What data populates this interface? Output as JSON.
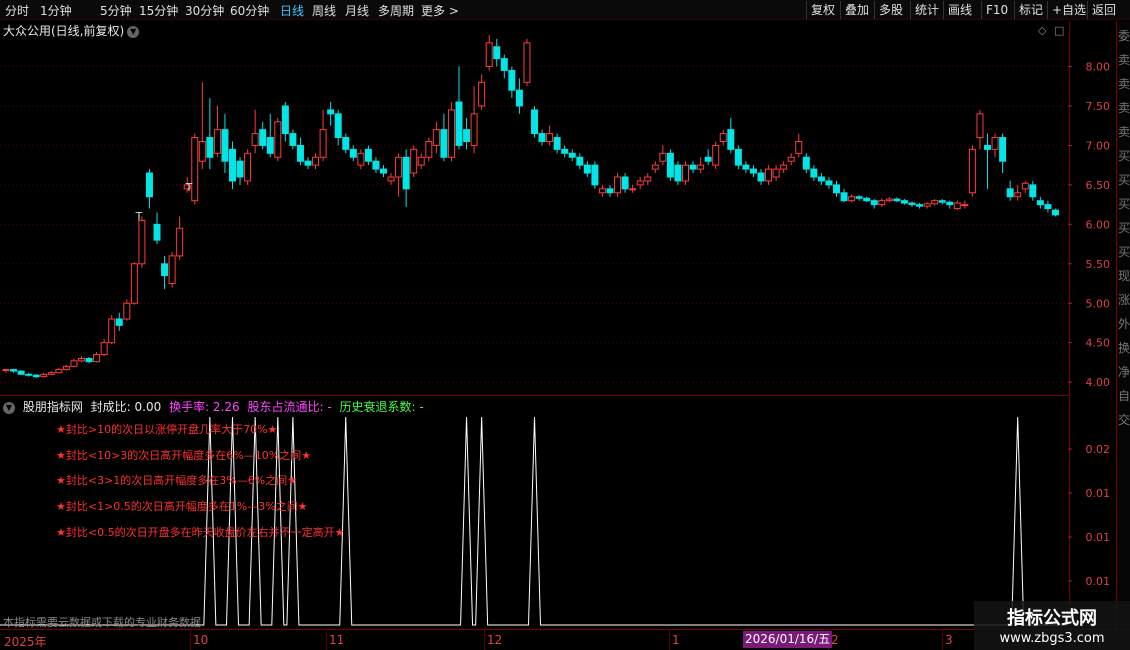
{
  "toolbar": {
    "periods": [
      "分时",
      "1分钟",
      "5分钟",
      "15分钟",
      "30分钟",
      "60分钟",
      "日线",
      "周线",
      "月线",
      "多周期",
      "更多 >"
    ],
    "active_period": "日线",
    "right_buttons": [
      "复权",
      "叠加",
      "多股",
      "统计",
      "画线",
      "F10",
      "标记",
      "+自选",
      "返回"
    ]
  },
  "main": {
    "title": "大众公用(日线,前复权)",
    "price_ticks": [
      "8.00",
      "7.50",
      "7.00",
      "6.50",
      "6.00",
      "5.50",
      "5.00",
      "4.50",
      "4.00"
    ],
    "markers": [
      "T",
      "T"
    ]
  },
  "sub": {
    "indicator_name": "股朋指标网",
    "seal_ratio": "封成比: 0.00",
    "turnover": "换手率: 2.26",
    "holder_ratio": "股东占流通比: -",
    "decline_coef": "历史衰退系数: -",
    "value_ticks": [
      "0.02",
      "0.01",
      "0.01",
      "0.01",
      "0.01"
    ],
    "notes": [
      "★封比>10的次日以涨停开盘几率大于70%★",
      "★封比<10>3的次日高开幅度多在6%—10%之间★",
      "★封比<3>1的次日高开幅度多在3%—6%之间★",
      "★封比<1>0.5的次日高开幅度多在1%—3%之间★",
      "★封比<0.5的次日开盘多在昨天收盘价左右并不一定高开★"
    ],
    "footer": "本指标需要云数据或下载的专业财务数据"
  },
  "axis": {
    "labels": [
      "2025年",
      "10",
      "11",
      "12",
      "1",
      "2",
      "3"
    ],
    "date_badge": "2026/01/16/五"
  },
  "right_strip_chars": [
    "委",
    "卖",
    "卖",
    "卖",
    "卖",
    "买",
    "买",
    "买",
    "买",
    "买",
    "现",
    "涨",
    "外",
    "换",
    "净",
    "自",
    "交"
  ],
  "watermark": {
    "title": "指标公式网",
    "url": "www.zbgs3.com"
  },
  "colors": {
    "up": "#ff3b3b",
    "down": "#00e5e5",
    "grid": "#5a0000",
    "active": "#3ec8ff"
  },
  "chart_data": {
    "type": "candlestick",
    "ylim": [
      3.85,
      8.45
    ],
    "candles": [
      [
        4.15,
        4.16,
        4.12,
        4.17
      ],
      [
        4.16,
        4.14,
        4.12,
        4.17
      ],
      [
        4.14,
        4.1,
        4.09,
        4.15
      ],
      [
        4.1,
        4.09,
        4.07,
        4.12
      ],
      [
        4.09,
        4.07,
        4.05,
        4.1
      ],
      [
        4.07,
        4.1,
        4.06,
        4.12
      ],
      [
        4.1,
        4.12,
        4.09,
        4.14
      ],
      [
        4.12,
        4.16,
        4.11,
        4.18
      ],
      [
        4.16,
        4.2,
        4.15,
        4.22
      ],
      [
        4.2,
        4.27,
        4.19,
        4.3
      ],
      [
        4.27,
        4.3,
        4.25,
        4.33
      ],
      [
        4.3,
        4.26,
        4.24,
        4.32
      ],
      [
        4.26,
        4.35,
        4.25,
        4.38
      ],
      [
        4.35,
        4.5,
        4.33,
        4.55
      ],
      [
        4.5,
        4.8,
        4.48,
        4.85
      ],
      [
        4.8,
        4.72,
        4.65,
        4.88
      ],
      [
        4.8,
        5.0,
        4.78,
        5.05
      ],
      [
        5.0,
        5.5,
        4.98,
        5.52
      ],
      [
        5.5,
        6.05,
        5.45,
        6.1
      ],
      [
        6.65,
        6.35,
        6.2,
        6.7
      ],
      [
        6.0,
        5.8,
        5.75,
        6.15
      ],
      [
        5.5,
        5.35,
        5.18,
        5.6
      ],
      [
        5.25,
        5.6,
        5.2,
        5.65
      ],
      [
        5.6,
        5.95,
        5.55,
        6.1
      ],
      [
        6.45,
        6.5,
        6.4,
        6.6
      ],
      [
        6.3,
        7.1,
        6.25,
        7.15
      ],
      [
        6.8,
        7.05,
        6.7,
        7.8
      ],
      [
        7.1,
        6.85,
        6.7,
        7.6
      ],
      [
        6.9,
        7.2,
        6.85,
        7.5
      ],
      [
        7.2,
        6.8,
        6.65,
        7.4
      ],
      [
        6.95,
        6.55,
        6.45,
        7.05
      ],
      [
        6.8,
        6.6,
        6.5,
        6.85
      ],
      [
        6.55,
        6.9,
        6.5,
        6.95
      ],
      [
        7.0,
        7.15,
        6.9,
        7.45
      ],
      [
        7.2,
        7.0,
        6.95,
        7.3
      ],
      [
        7.1,
        6.9,
        6.85,
        7.4
      ],
      [
        6.85,
        7.3,
        6.8,
        7.35
      ],
      [
        7.5,
        7.15,
        7.05,
        7.55
      ],
      [
        7.15,
        7.0,
        6.95,
        7.2
      ],
      [
        7.0,
        6.8,
        6.75,
        7.1
      ],
      [
        6.8,
        6.75,
        6.7,
        6.85
      ],
      [
        6.75,
        6.85,
        6.7,
        6.9
      ],
      [
        6.85,
        7.2,
        6.8,
        7.45
      ],
      [
        7.45,
        7.4,
        7.25,
        7.55
      ],
      [
        7.4,
        7.1,
        7.0,
        7.45
      ],
      [
        7.1,
        6.95,
        6.9,
        7.15
      ],
      [
        6.95,
        6.85,
        6.8,
        7.0
      ],
      [
        6.75,
        6.9,
        6.7,
        6.95
      ],
      [
        6.95,
        6.8,
        6.75,
        7.0
      ],
      [
        6.8,
        6.7,
        6.65,
        6.85
      ],
      [
        6.7,
        6.65,
        6.6,
        6.75
      ],
      [
        6.55,
        6.6,
        6.5,
        6.65
      ],
      [
        6.6,
        6.85,
        6.35,
        6.9
      ],
      [
        6.85,
        6.45,
        6.22,
        6.95
      ],
      [
        6.65,
        6.95,
        6.6,
        7.0
      ],
      [
        6.75,
        6.85,
        6.7,
        6.9
      ],
      [
        6.85,
        7.05,
        6.8,
        7.1
      ],
      [
        7.0,
        7.2,
        6.9,
        7.3
      ],
      [
        7.2,
        6.85,
        6.8,
        7.4
      ],
      [
        6.85,
        7.45,
        6.8,
        7.55
      ],
      [
        7.55,
        7.0,
        6.95,
        8.0
      ],
      [
        7.2,
        7.05,
        6.95,
        7.35
      ],
      [
        7.0,
        7.4,
        6.9,
        7.75
      ],
      [
        7.5,
        7.8,
        7.45,
        7.9
      ],
      [
        8.0,
        8.3,
        7.95,
        8.4
      ],
      [
        8.25,
        8.1,
        8.0,
        8.35
      ],
      [
        8.1,
        7.95,
        7.85,
        8.15
      ],
      [
        7.95,
        7.7,
        7.6,
        8.0
      ],
      [
        7.7,
        7.5,
        7.4,
        7.85
      ],
      [
        7.8,
        8.3,
        7.75,
        8.35
      ],
      [
        7.45,
        7.15,
        7.1,
        7.5
      ],
      [
        7.15,
        7.05,
        7.0,
        7.2
      ],
      [
        7.05,
        7.15,
        7.0,
        7.25
      ],
      [
        7.1,
        6.95,
        6.9,
        7.15
      ],
      [
        6.95,
        6.9,
        6.85,
        7.0
      ],
      [
        6.9,
        6.85,
        6.8,
        6.95
      ],
      [
        6.85,
        6.75,
        6.7,
        6.9
      ],
      [
        6.75,
        6.65,
        6.6,
        6.8
      ],
      [
        6.75,
        6.5,
        6.45,
        6.8
      ],
      [
        6.4,
        6.45,
        6.35,
        6.5
      ],
      [
        6.45,
        6.4,
        6.35,
        6.5
      ],
      [
        6.4,
        6.6,
        6.35,
        6.65
      ],
      [
        6.6,
        6.45,
        6.4,
        6.65
      ],
      [
        6.45,
        6.45,
        6.4,
        6.5
      ],
      [
        6.5,
        6.55,
        6.45,
        6.6
      ],
      [
        6.55,
        6.6,
        6.5,
        6.65
      ],
      [
        6.7,
        6.75,
        6.65,
        6.8
      ],
      [
        6.8,
        6.9,
        6.75,
        7.0
      ],
      [
        6.9,
        6.6,
        6.55,
        6.95
      ],
      [
        6.75,
        6.55,
        6.5,
        6.8
      ],
      [
        6.55,
        6.75,
        6.5,
        6.8
      ],
      [
        6.75,
        6.7,
        6.65,
        6.8
      ],
      [
        6.7,
        6.75,
        6.65,
        6.85
      ],
      [
        6.85,
        6.8,
        6.75,
        6.95
      ],
      [
        6.75,
        7.0,
        6.7,
        7.05
      ],
      [
        7.05,
        7.15,
        7.0,
        7.2
      ],
      [
        7.2,
        6.95,
        6.9,
        7.35
      ],
      [
        6.95,
        6.75,
        6.7,
        7.0
      ],
      [
        6.75,
        6.7,
        6.65,
        6.8
      ],
      [
        6.7,
        6.65,
        6.6,
        6.75
      ],
      [
        6.65,
        6.55,
        6.5,
        6.7
      ],
      [
        6.55,
        6.7,
        6.5,
        6.75
      ],
      [
        6.6,
        6.7,
        6.55,
        6.75
      ],
      [
        6.7,
        6.75,
        6.65,
        6.8
      ],
      [
        6.8,
        6.85,
        6.75,
        6.9
      ],
      [
        6.9,
        7.05,
        6.85,
        7.15
      ],
      [
        6.85,
        6.7,
        6.65,
        6.9
      ],
      [
        6.7,
        6.6,
        6.55,
        6.75
      ],
      [
        6.6,
        6.55,
        6.5,
        6.65
      ],
      [
        6.55,
        6.5,
        6.45,
        6.6
      ],
      [
        6.5,
        6.4,
        6.35,
        6.55
      ],
      [
        6.4,
        6.3,
        6.28,
        6.45
      ],
      [
        6.3,
        6.35,
        6.28,
        6.38
      ],
      [
        6.35,
        6.33,
        6.3,
        6.37
      ],
      [
        6.33,
        6.3,
        6.28,
        6.35
      ],
      [
        6.3,
        6.25,
        6.2,
        6.32
      ],
      [
        6.25,
        6.3,
        6.22,
        6.33
      ],
      [
        6.3,
        6.32,
        6.28,
        6.35
      ],
      [
        6.32,
        6.3,
        6.28,
        6.34
      ],
      [
        6.3,
        6.27,
        6.25,
        6.32
      ],
      [
        6.27,
        6.25,
        6.22,
        6.29
      ],
      [
        6.25,
        6.23,
        6.2,
        6.27
      ],
      [
        6.23,
        6.26,
        6.2,
        6.28
      ],
      [
        6.26,
        6.3,
        6.24,
        6.32
      ],
      [
        6.3,
        6.28,
        6.25,
        6.32
      ],
      [
        6.28,
        6.25,
        6.2,
        6.3
      ],
      [
        6.2,
        6.27,
        6.18,
        6.3
      ],
      [
        6.25,
        6.25,
        6.2,
        6.3
      ],
      [
        6.4,
        6.95,
        6.35,
        7.0
      ],
      [
        7.1,
        7.4,
        6.95,
        7.45
      ],
      [
        7.0,
        6.95,
        6.45,
        7.15
      ],
      [
        6.95,
        7.1,
        6.85,
        7.15
      ],
      [
        7.1,
        6.8,
        6.65,
        7.15
      ],
      [
        6.45,
        6.35,
        6.3,
        6.55
      ],
      [
        6.35,
        6.4,
        6.3,
        6.5
      ],
      [
        6.45,
        6.52,
        6.4,
        6.55
      ],
      [
        6.5,
        6.35,
        6.3,
        6.55
      ],
      [
        6.3,
        6.25,
        6.2,
        6.35
      ],
      [
        6.25,
        6.2,
        6.15,
        6.3
      ],
      [
        6.18,
        6.12,
        6.1,
        6.2
      ]
    ],
    "indicator_peaks": [
      27,
      30,
      33,
      36,
      38,
      45,
      61,
      63,
      70,
      134
    ]
  }
}
